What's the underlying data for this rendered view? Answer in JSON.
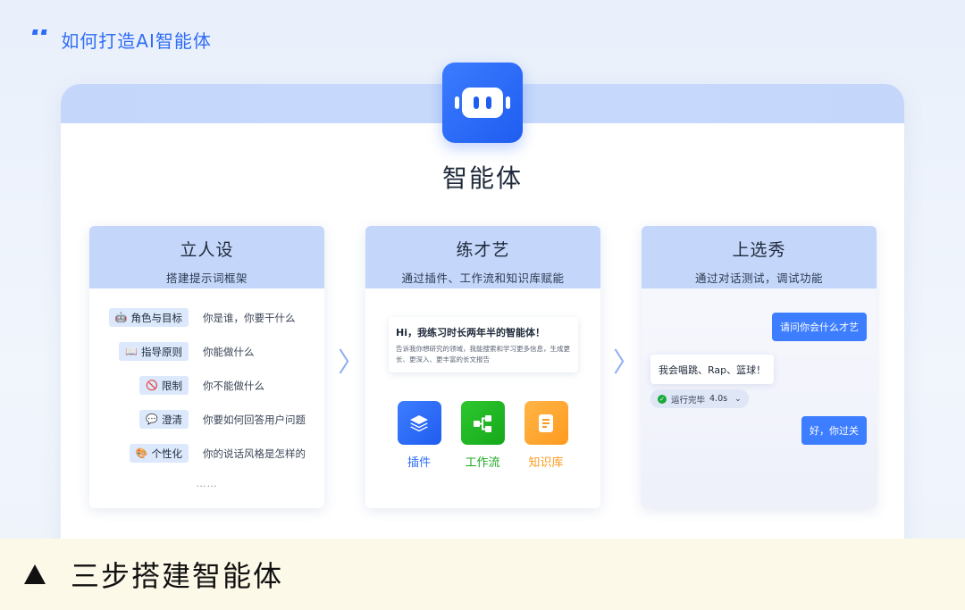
{
  "header": {
    "quote_mark": "“",
    "title": "如何打造AI智能体"
  },
  "agent_title": "智能体",
  "cards": [
    {
      "title": "立人设",
      "subtitle": "搭建提示词框架",
      "rows": [
        {
          "icon": "robot-icon",
          "glyph": "🤖",
          "chip": "角色与目标",
          "desc": "你是谁，你要干什么"
        },
        {
          "icon": "book-icon",
          "glyph": "📖",
          "chip": "指导原则",
          "desc": "你能做什么"
        },
        {
          "icon": "prohibited-icon",
          "glyph": "🚫",
          "chip": "限制",
          "desc": "你不能做什么"
        },
        {
          "icon": "speech-bubble-icon",
          "glyph": "💬",
          "chip": "澄清",
          "desc": "你要如何回答用户问题"
        },
        {
          "icon": "palette-icon",
          "glyph": "🎨",
          "chip": "个性化",
          "desc": "你的说话风格是怎样的"
        }
      ],
      "ellipsis": "……"
    },
    {
      "title": "练才艺",
      "subtitle": "通过插件、工作流和知识库赋能",
      "chat_title": "Hi，我练习时长两年半的智能体！",
      "chat_body": "告诉我你想研究的领域，我能搜索和学习更多信息，生成更长、更深入、更丰富的长文报告",
      "skills": [
        {
          "icon": "layers-icon",
          "label": "插件"
        },
        {
          "icon": "workflow-icon",
          "label": "工作流"
        },
        {
          "icon": "document-icon",
          "label": "知识库"
        }
      ]
    },
    {
      "title": "上选秀",
      "subtitle": "通过对话测试，调试功能",
      "user_msg_1": "请问你会什么才艺",
      "bot_msg": "我会唱跳、Rap、篮球！",
      "run_status": "运行完毕",
      "run_time": "4.0s",
      "user_msg_2": "好，你过关"
    }
  ],
  "arrows": [
    "〉",
    "〉"
  ],
  "footer": {
    "caption": "三步搭建智能体"
  },
  "colors": {
    "accent": "#2f6cf6",
    "band": "#c4d7fb",
    "green": "#1aaa1f",
    "orange": "#ff9a1f",
    "footer_bg": "#fdf9e8"
  }
}
